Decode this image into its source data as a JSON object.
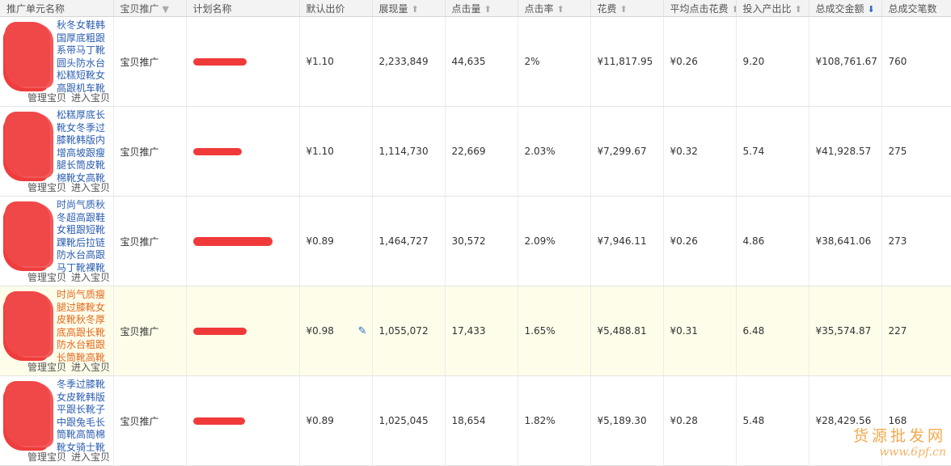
{
  "headers": {
    "unit": "推广单元名称",
    "type": "宝贝推广",
    "plan": "计划名称",
    "bid": "默认出价",
    "impressions": "展现量",
    "clicks": "点击量",
    "ctr": "点击率",
    "cost": "花费",
    "cpc": "平均点击花费",
    "roi": "投入产出比",
    "gmv": "总成交金额",
    "orders": "总成交笔数"
  },
  "sort_icons": {
    "dropdown": "▼",
    "asc": "⬆",
    "desc": "⬇"
  },
  "links": {
    "manage": "管理宝贝",
    "enter": "进入宝贝"
  },
  "colors": {
    "link": "#2a5db0",
    "highlight_title": "#e2691e",
    "redaction": "#f03a3a",
    "highlight_row": "#fdfdea"
  },
  "rows": [
    {
      "title": "秋冬女鞋韩国厚底粗跟系带马丁靴圆头防水台松糕短靴女高跟机车靴",
      "type": "宝贝推广",
      "bid": "¥1.10",
      "impressions": "2,233,849",
      "clicks": "44,635",
      "ctr": "2%",
      "cost": "¥11,817.95",
      "cpc": "¥0.26",
      "roi": "9.20",
      "gmv": "¥108,761.67",
      "orders": "760"
    },
    {
      "title": "松糕厚底长靴女冬季过膝靴韩版内增高坡跟瘦腿长筒皮靴棉靴女高靴",
      "type": "宝贝推广",
      "bid": "¥1.10",
      "impressions": "1,114,730",
      "clicks": "22,669",
      "ctr": "2.03%",
      "cost": "¥7,299.67",
      "cpc": "¥0.32",
      "roi": "5.74",
      "gmv": "¥41,928.57",
      "orders": "275"
    },
    {
      "title": "时尚气质秋冬超高跟鞋女粗跟短靴踝靴后拉链防水台高跟马丁靴裸靴",
      "type": "宝贝推广",
      "bid": "¥0.89",
      "impressions": "1,464,727",
      "clicks": "30,572",
      "ctr": "2.09%",
      "cost": "¥7,946.11",
      "cpc": "¥0.26",
      "roi": "4.86",
      "gmv": "¥38,641.06",
      "orders": "273"
    },
    {
      "title": "时尚气质瘦腿过膝靴女皮靴秋冬厚底高跟长靴防水台粗跟长筒靴高靴",
      "type": "宝贝推广",
      "bid": "¥0.98",
      "impressions": "1,055,072",
      "clicks": "17,433",
      "ctr": "1.65%",
      "cost": "¥5,488.81",
      "cpc": "¥0.31",
      "roi": "6.48",
      "gmv": "¥35,574.87",
      "orders": "227"
    },
    {
      "title": "冬季过膝靴女皮靴韩版平跟长靴子中跟兔毛长筒靴高筒棉靴女骑士靴",
      "type": "宝贝推广",
      "bid": "¥0.89",
      "impressions": "1,025,045",
      "clicks": "18,654",
      "ctr": "1.82%",
      "cost": "¥5,189.30",
      "cpc": "¥0.28",
      "roi": "5.48",
      "gmv": "¥28,429.56",
      "orders": "168"
    }
  ],
  "watermark": {
    "line1": "货源批发网",
    "line2": "www.6pf.cn"
  }
}
